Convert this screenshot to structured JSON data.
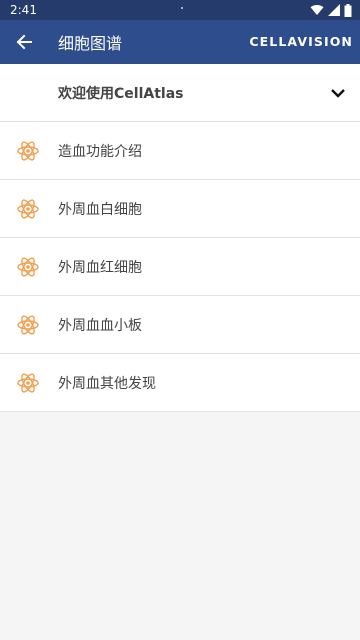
{
  "status_bar": {
    "time": "2:41",
    "icons": [
      "wifi-icon",
      "signal-icon",
      "battery-icon"
    ]
  },
  "app_bar": {
    "title": "细胞图谱",
    "brand": "CELLAVISION",
    "back_icon": "back-arrow-icon"
  },
  "welcome": {
    "label": "欢迎使用CellAtlas",
    "expand_icon": "chevron-down-icon"
  },
  "menu": {
    "icon": "atom-icon",
    "icon_color": "#f0a050",
    "items": [
      {
        "label": "造血功能介绍"
      },
      {
        "label": "外周血白细胞"
      },
      {
        "label": "外周血红细胞"
      },
      {
        "label": "外周血血小板"
      },
      {
        "label": "外周血其他发现"
      }
    ]
  },
  "colors": {
    "status_bar": "#243b6b",
    "app_bar": "#2d4d8c",
    "background": "#f5f5f5"
  }
}
